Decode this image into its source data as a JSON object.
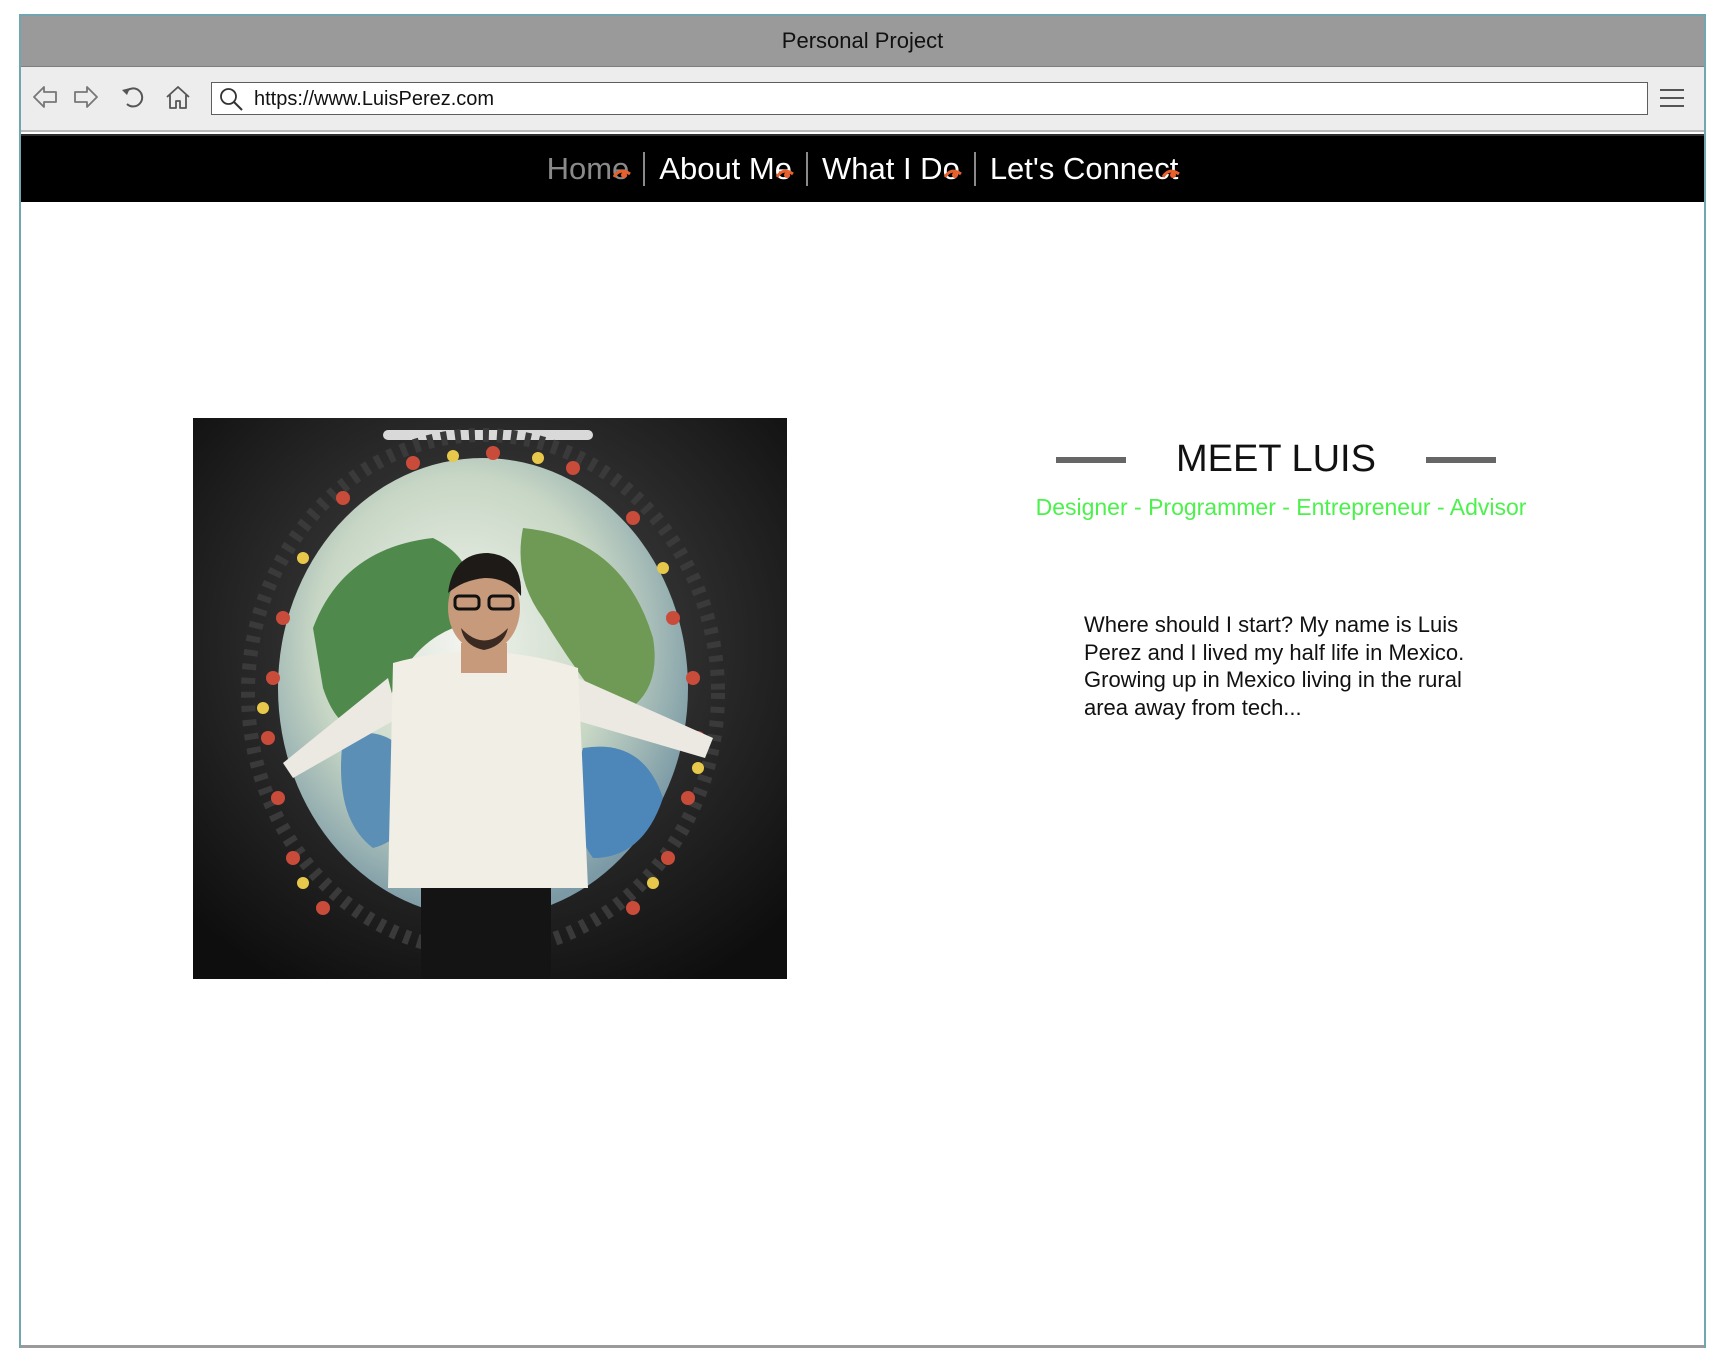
{
  "window": {
    "title": "Personal Project"
  },
  "browser": {
    "url": "https://www.LuisPerez.com",
    "icons": [
      "back-icon",
      "forward-icon",
      "reload-icon",
      "home-icon",
      "search-icon",
      "menu-icon"
    ]
  },
  "nav": {
    "items": [
      {
        "label": "Home",
        "active": true
      },
      {
        "label": "About Me",
        "active": false
      },
      {
        "label": "What I Do",
        "active": false
      },
      {
        "label": "Let's Connect",
        "active": false
      }
    ],
    "accent_color": "#e8602c"
  },
  "hero": {
    "photo_description": "photo of Luis Perez standing in front of a globe sculpture",
    "heading": "MEET LUIS",
    "roles": "Designer - Programmer - Entrepreneur - Advisor",
    "intro": "Where should I start? My name is Luis Perez and I lived my half life in Mexico. Growing up in Mexico living in the rural area away from tech...",
    "roles_color": "#4cf14c"
  }
}
